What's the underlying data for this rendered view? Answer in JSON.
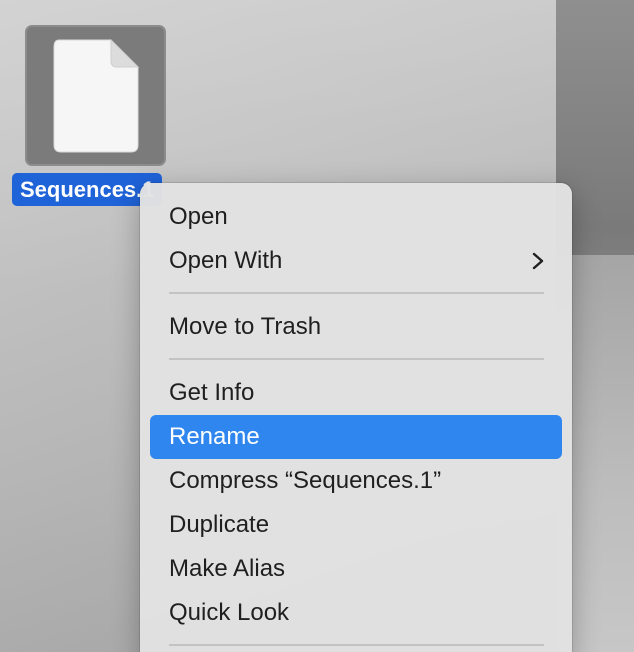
{
  "desktop": {
    "file_icon": {
      "icon": "document-icon",
      "label": "Sequences.1"
    }
  },
  "context_menu": {
    "items": [
      {
        "label": "Open"
      },
      {
        "label": "Open With",
        "submenu_icon": "chevron-right-icon"
      },
      {
        "label": "Move to Trash"
      },
      {
        "label": "Get Info"
      },
      {
        "label": "Rename",
        "highlighted": true
      },
      {
        "label": "Compress “Sequences.1”"
      },
      {
        "label": "Duplicate"
      },
      {
        "label": "Make Alias"
      },
      {
        "label": "Quick Look"
      }
    ]
  },
  "colors": {
    "selection_blue": "#1f63d9",
    "menu_highlight": "#2f86ee",
    "menu_background": "#e2e2e2"
  }
}
